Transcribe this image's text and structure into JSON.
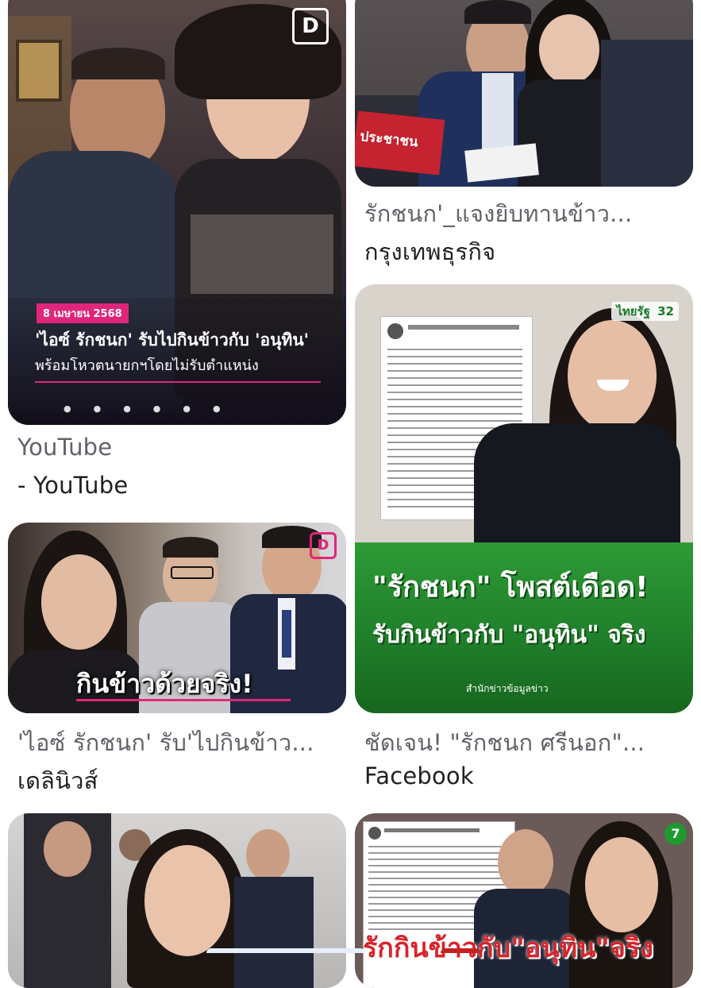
{
  "results": [
    {
      "title": "YouTube",
      "source": "- YouTube",
      "thumb": {
        "logo": "D",
        "date": "8 เมษายน 2568",
        "headline_1": "'ไอซ์ รักชนก' รับไปกินข้าวกับ 'อนุทิน'",
        "headline_2": "พร้อมโหวตนายกฯโดยไม่รับตำแหน่ง",
        "accent": "#e0267a"
      }
    },
    {
      "title": "รักชนก'_แจงยิบทานข้าว...",
      "source": "กรุงเทพธุรกิจ",
      "thumb": {
        "sign": "ประชาชน"
      }
    },
    {
      "title": "'ไอซ์ รักชนก' รับ'ไปกินข้าว...",
      "source": "เดลินิวส์",
      "thumb": {
        "logo": "D",
        "headline": "กินข้าวด้วยจริง!",
        "accent": "#e0267a"
      }
    },
    {
      "title": "ชัดเจน! \"รักชนก ศรีนอก\"...",
      "source": "Facebook",
      "thumb": {
        "channel": "ไทยรัฐ",
        "channel_num": "32",
        "headline_1": "\"รักชนก\" โพสต์เดือด!",
        "headline_2": "รับกินข้าวกับ \"อนุทิน\" จริง",
        "footer": "สำนักข่าวข้อมูลข่าว",
        "accent": "#1e8a2e"
      }
    },
    {
      "title": "",
      "source": "",
      "thumb": {}
    },
    {
      "title": "",
      "source": "",
      "thumb": {
        "headline": "รักกินข้าวกับ\"อนุทิน\"จริง",
        "badge": "7"
      }
    }
  ]
}
